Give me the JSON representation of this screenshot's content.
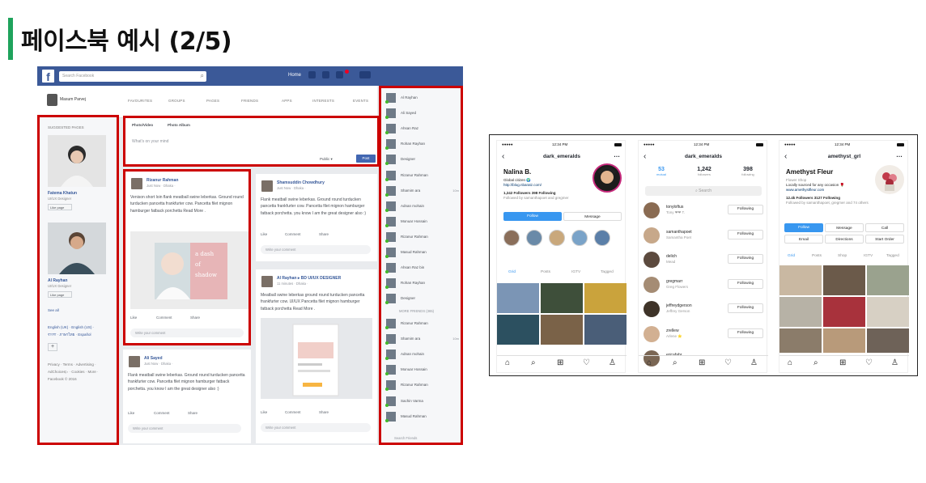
{
  "slide": {
    "title": "페이스북 예시 (2/5)"
  },
  "facebook": {
    "logo": "f",
    "search_placeholder": "Search Facebook",
    "home": "Home",
    "user_name": "Masum Parvej",
    "nav_tabs": [
      "FAVOURITES",
      "GROUPS",
      "PAGES",
      "FRIENDS",
      "APPS",
      "INTERESTS",
      "EVENTS"
    ],
    "suggested_pages": "SUGGESTED PAGES",
    "pages": [
      {
        "name": "Fatema Khatun",
        "sub": "UI/UX Designer",
        "like": "Like page"
      },
      {
        "name": "Al Rayhan",
        "sub": "UI/UX Designer",
        "like": "Like page"
      }
    ],
    "see_all": "See all",
    "languages": [
      "English (UK) · English (US) ·",
      "বাংলা · ภาษาไทย · Español"
    ],
    "plus": "+",
    "footer": [
      "Privacy · Terms · Advertising ·",
      "AdChoices▷ · Cookies · More ·",
      "Facebook © 2016"
    ],
    "composer": {
      "tab_photo_video": "Photo/Video",
      "tab_photo_album": "Photo Album",
      "placeholder": "What's on your mind",
      "privacy": "Public ▾",
      "post": "Post"
    },
    "actions": {
      "like": "Like",
      "comment": "Comment",
      "share": "Share",
      "write_comment": "Write your comment"
    },
    "posts": [
      {
        "name": "Rizanur Rahman",
        "time": "Just Now · Dhaka ·",
        "body": "Venison short loin flank meatball swine leberkas. Ground round turducken pancetta frankfurter cow. Pancetta filet mignon hamburger fatback porchetta Read More .",
        "img_text": [
          "a dash",
          "of",
          "shadow"
        ]
      },
      {
        "name": "Ali Sayed",
        "time": "Just Now · Dhaka ·",
        "body": "Flank meatball swine leberkas. Ground round turducken pancetta frankfurter cow. Pancetta filet mignon hamburger fatback porchetta. you know I am the great designer also :)"
      },
      {
        "name": "Shamsuddin Chowdhury",
        "time": "Just Now · Dhaka ·",
        "body": "Flank meatball swine leberkas. Ground round turducken pancetta frankfurter cow. Pancetta filet mignon hamburger fatback porchetta. you know I am the great designer also :)"
      },
      {
        "name": "Al Rayhan",
        "shared": "▸ BD UI/UX DESIGNER",
        "time": "11 minutes · Dhaka ·",
        "body": "Meatball swine leberkas ground round turducken pancetta frankfurter cow. UI/UX Pancetta filet mignon hamburger fatback porchetta Read More ."
      }
    ],
    "friends": [
      {
        "name": "Al Rayhan"
      },
      {
        "name": "Ali Sayed"
      },
      {
        "name": "Ahsan Raz"
      },
      {
        "name": "Rohan Rayhan"
      },
      {
        "name": "Designer"
      },
      {
        "name": "Rizanur Rahman"
      },
      {
        "name": "Shamim ara",
        "time": "10m"
      },
      {
        "name": "Adnan mohain"
      },
      {
        "name": "Monuar Hossain"
      },
      {
        "name": "Rizanur Rahman"
      },
      {
        "name": "Masud Rahman"
      },
      {
        "name": "Ahsan Raz bin"
      },
      {
        "name": "Rohan Rayhan"
      },
      {
        "name": "Designer"
      }
    ],
    "more_friends": "MORE FRIENDS (365)",
    "more_friends_list": [
      {
        "name": "Rizanur Rahman"
      },
      {
        "name": "Shamim ara",
        "time": "10m"
      },
      {
        "name": "Adnan mohain"
      },
      {
        "name": "Monuar Hossain"
      },
      {
        "name": "Rizanur Rahman"
      },
      {
        "name": "Sachin Varma"
      },
      {
        "name": "Masud Rahman"
      }
    ],
    "search_friends": "Search Friends"
  },
  "instagram": {
    "status_time": "12:34 PM",
    "status_left": "●●●●●",
    "phone1": {
      "username": "dark_emeralds",
      "name": "Nalina B.",
      "bio": "Global citizen 🌍",
      "link": "http://blog.nbaratz.com/",
      "followers_line": "1,242 Followers  398 Following",
      "followed_by": "Followed by samanthapoet and gregmer",
      "follow": "Follow",
      "message": "Message",
      "tabs": [
        "Grid",
        "Posts",
        "IGTV",
        "Tagged"
      ]
    },
    "phone2": {
      "username": "dark_emeralds",
      "stats": [
        {
          "n": "53",
          "l": "mutual"
        },
        {
          "n": "1,242",
          "l": "followers"
        },
        {
          "n": "398",
          "l": "following"
        }
      ],
      "search": "Search",
      "rows": [
        {
          "user": "tonyloftus",
          "name": "Tony ❤❤ T."
        },
        {
          "user": "samanthapoet",
          "name": "Samantha Poet"
        },
        {
          "user": "delich",
          "name": "Mead"
        },
        {
          "user": "gregmarr",
          "name": "Greg Flowers"
        },
        {
          "user": "jeffreydgerson",
          "name": "Jeffrey Gerson"
        },
        {
          "user": "zrellew",
          "name": "Arlene ⭐"
        },
        {
          "user": "ericafahr",
          "name": ""
        }
      ],
      "following": "Following"
    },
    "phone3": {
      "username": "amethyst_grl",
      "name": "Amethyst Fleur",
      "category": "Flower Shop",
      "bio": "Locally sourced for any occasion 🌹",
      "link": "www.amethystfleur.com",
      "followers_line": "12.4k Followers  3127 Following",
      "followed_by": "Followed by samanthapoet, gregmer and 74 others",
      "buttons": [
        "Follow",
        "Message",
        "Call",
        "Email",
        "Directions",
        "Start Order"
      ],
      "tabs": [
        "Grid",
        "Posts",
        "Shop",
        "IGTV",
        "Tagged"
      ]
    }
  }
}
